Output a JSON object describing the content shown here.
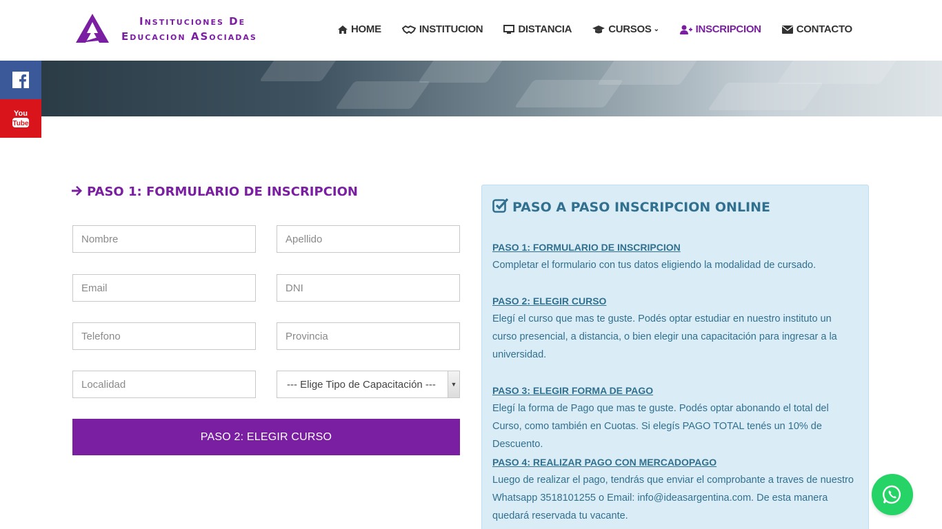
{
  "brand": {
    "line1": "Instituciones De",
    "line2": "Educacion ASociadas",
    "color": "#7b1fa2"
  },
  "nav": [
    {
      "label": "HOME",
      "icon": "home-icon"
    },
    {
      "label": "INSTITUCION",
      "icon": "handshake-icon"
    },
    {
      "label": "DISTANCIA",
      "icon": "desktop-icon"
    },
    {
      "label": "CURSOS",
      "icon": "graduation-cap-icon",
      "dropdown": true
    },
    {
      "label": "INSCRIPCION",
      "icon": "user-plus-icon",
      "active": true
    },
    {
      "label": "CONTACTO",
      "icon": "envelope-icon"
    }
  ],
  "social": [
    {
      "name": "facebook",
      "color": "#3b5998"
    },
    {
      "name": "youtube",
      "color": "#d9141b"
    }
  ],
  "form": {
    "title": "PASO 1: FORMULARIO DE INSCRIPCION",
    "placeholders": {
      "nombre": "Nombre",
      "apellido": "Apellido",
      "email": "Email",
      "dni": "DNI",
      "telefono": "Telefono",
      "provincia": "Provincia",
      "localidad": "Localidad"
    },
    "select_value": "--- Elige Tipo de Capacitación ---",
    "submit_label": "PASO 2: ELEGIR CURSO"
  },
  "info": {
    "title": "PASO A PASO INSCRIPCION ONLINE",
    "steps": [
      {
        "title": "PASO 1: FORMULARIO DE INSCRIPCION",
        "text": "Completar el formulario con tus datos eligiendo la modalidad de cursado."
      },
      {
        "title": "PASO 2: ELEGIR CURSO",
        "text": "Elegí el curso que mas te guste. Podés optar estudiar en nuestro instituto un curso presencial, a distancia, o bien elegir una capacitación para ingresar a la universidad."
      },
      {
        "title": "PASO 3: ELEGIR FORMA DE PAGO",
        "text": "Elegí la forma de Pago que mas te guste. Podés optar abonando el total del Curso, como también en Cuotas. Si elegís PAGO TOTAL tenés un 10% de Descuento."
      },
      {
        "title": "PASO 4: REALIZAR PAGO CON MERCADOPAGO",
        "text": "Luego de realizar el pago, tendrás que enviar el comprobante a traves de nuestro Whatsapp 3518101255 o Email: info@ideasargentina.com. De esta manera quedará reservada tu vacante."
      }
    ]
  },
  "colors": {
    "accent": "#7b1fa2",
    "info_text": "#31708f",
    "info_bg": "#daedf7",
    "whatsapp": "#25d366"
  }
}
